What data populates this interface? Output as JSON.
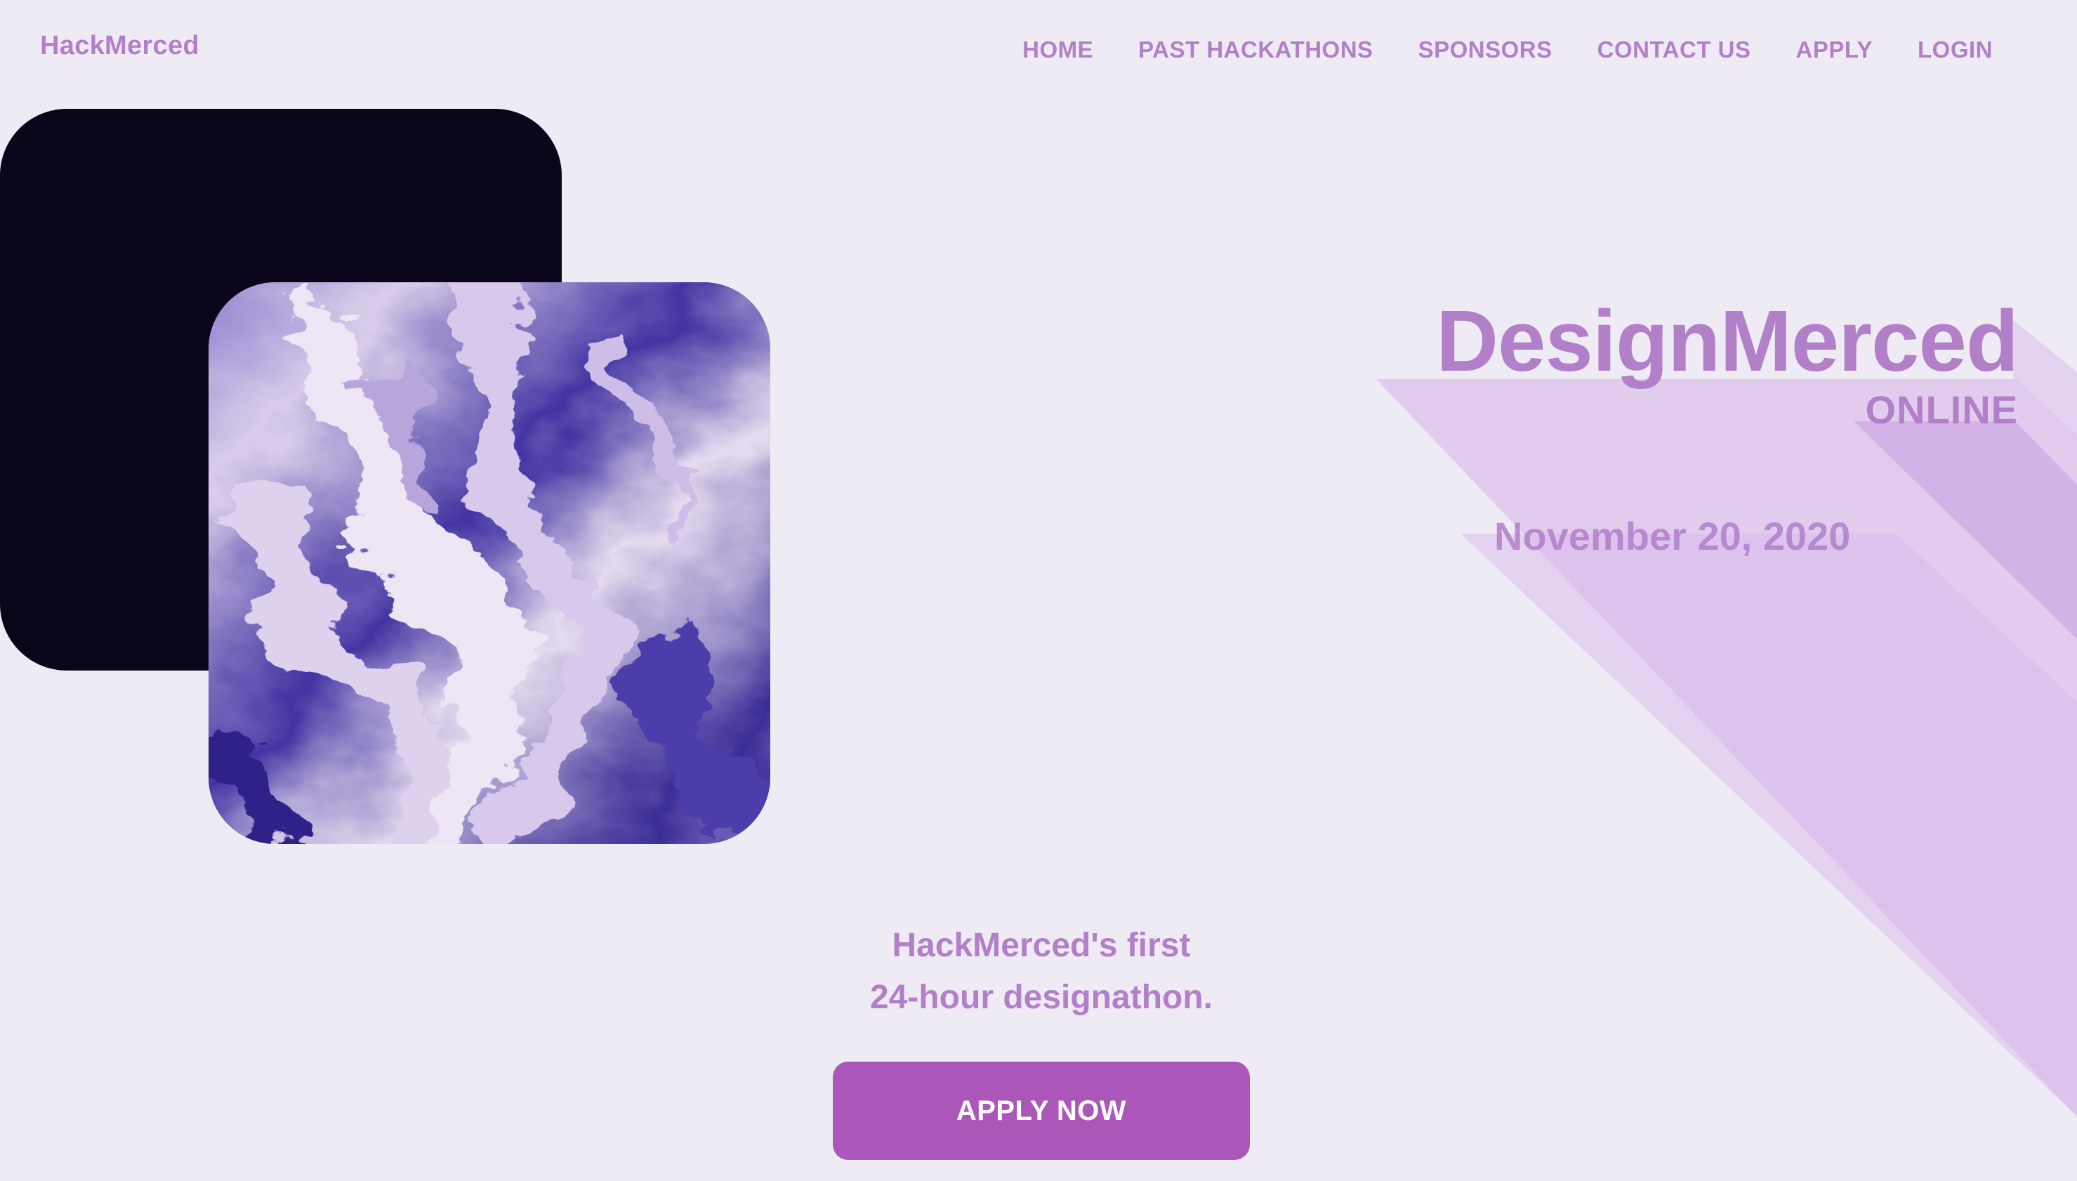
{
  "header": {
    "brand": "HackMerced",
    "nav": [
      {
        "label": "HOME"
      },
      {
        "label": "PAST HACKATHONS"
      },
      {
        "label": "SPONSORS"
      },
      {
        "label": "CONTACT US"
      },
      {
        "label": "APPLY"
      },
      {
        "label": "LOGIN"
      }
    ]
  },
  "hero": {
    "title": "DesignMerced",
    "subtitle": "ONLINE",
    "date": "November 20, 2020",
    "tagline_line1": "HackMerced's first",
    "tagline_line2": "24-hour designathon.",
    "cta_label": "APPLY NOW"
  },
  "colors": {
    "background": "#efebf4",
    "accent": "#b27fc9",
    "button": "#ab57ba",
    "dark_card": "#0b051c",
    "art_blue": "#3b2f9a"
  }
}
